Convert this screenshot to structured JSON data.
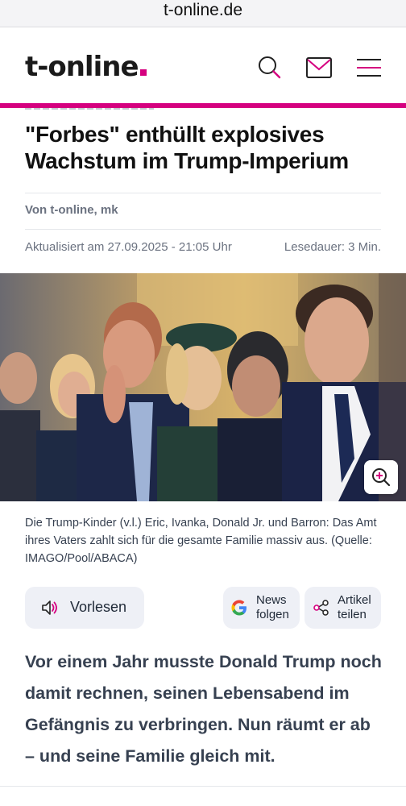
{
  "browser": {
    "url": "t-online.de"
  },
  "header": {
    "logo_text": "t-online",
    "accent_color": "#d5007f",
    "icons": [
      "search-icon",
      "mail-icon",
      "menu-icon"
    ]
  },
  "article": {
    "headline": "\"Forbes\" enthüllt explosives Wachstum im Trump-Imperium",
    "author": "Von t-online, mk",
    "updated": "Aktualisiert am 27.09.2025 - 21:05 Uhr",
    "reading_time": "Lesedauer: 3 Min.",
    "image_caption": "Die Trump-Kinder (v.l.) Eric, Ivanka, Donald Jr. und Barron: Das Amt ihres Vaters zahlt sich für die gesamte Familie massiv aus. (Quelle: IMAGO/Pool/ABACA)",
    "lead": "Vor einem Jahr musste Donald Trump noch damit rechnen, seinen Lebensabend im Gefängnis zu verbringen. Nun räumt er ab – und seine Familie gleich mit."
  },
  "actions": {
    "read_aloud": "Vorlesen",
    "google_news_line1": "News",
    "google_news_line2": "folgen",
    "share_line1": "Artikel",
    "share_line2": "teilen"
  }
}
